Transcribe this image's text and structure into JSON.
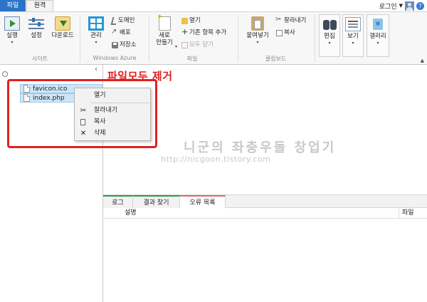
{
  "tabs": {
    "file": "파일",
    "remote": "원격"
  },
  "account": {
    "login_label": "로그인",
    "help": "?"
  },
  "ribbon": {
    "site_group": {
      "label": "사이트",
      "run": "실행",
      "settings": "설정",
      "download": "다운로드"
    },
    "azure_group": {
      "label": "Windows Azure",
      "manage": "관리",
      "domain": "도메인",
      "publish": "배포",
      "storage": "저장소"
    },
    "file_group": {
      "label": "파일",
      "new_line1": "새로",
      "new_line2": "만들기",
      "open": "열기",
      "add_existing": "기존 항목 추가",
      "close_all": "모두 닫기"
    },
    "clipboard_group": {
      "label": "클립보드",
      "paste": "붙여넣기",
      "cut": "잘라내기",
      "copy": "복사"
    },
    "edit": "편집",
    "view": "보기",
    "gallery": "갤러리"
  },
  "files": [
    {
      "name": "favicon.ico"
    },
    {
      "name": "index.php"
    }
  ],
  "context_menu": {
    "open": "열기",
    "cut": "잘라내기",
    "copy": "복사",
    "delete": "삭제"
  },
  "annotation": "파일모두 제거",
  "watermark": {
    "title": "니군의 좌충우돌 창업기",
    "url": "http://nicgoon.tistory.com"
  },
  "bottom": {
    "tabs": [
      "로그",
      "결과 찾기",
      "오류 목록"
    ],
    "columns": {
      "description": "설명",
      "file": "파일"
    }
  },
  "colors": {
    "accent_blue": "#2b74c7",
    "annotation_red": "#e02020",
    "selection": "#cde6f7"
  }
}
